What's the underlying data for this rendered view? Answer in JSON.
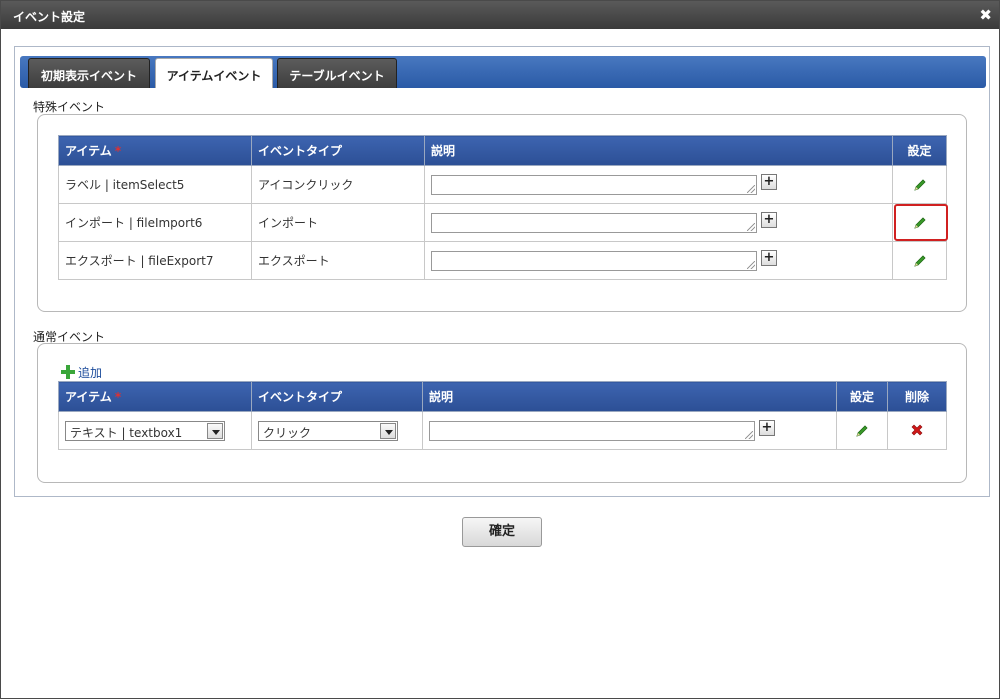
{
  "dialog": {
    "title": "イベント設定",
    "close_symbol": "✖"
  },
  "tabs": [
    {
      "label": "初期表示イベント",
      "active": false
    },
    {
      "label": "アイテムイベント",
      "active": true
    },
    {
      "label": "テーブルイベント",
      "active": false
    }
  ],
  "special_events": {
    "legend": "特殊イベント",
    "headers": {
      "item": "アイテム",
      "required_mark": "*",
      "event_type": "イベントタイプ",
      "description": "説明",
      "settings": "設定"
    },
    "rows": [
      {
        "item": "ラベル | itemSelect5",
        "event_type": "アイコンクリック",
        "description": ""
      },
      {
        "item": "インポート | fileImport6",
        "event_type": "インポート",
        "description": "",
        "highlighted": true
      },
      {
        "item": "エクスポート | fileExport7",
        "event_type": "エクスポート",
        "description": ""
      }
    ]
  },
  "normal_events": {
    "legend": "通常イベント",
    "add_label": "追加",
    "headers": {
      "item": "アイテム",
      "required_mark": "*",
      "event_type": "イベントタイプ",
      "description": "説明",
      "settings": "設定",
      "delete": "削除"
    },
    "rows": [
      {
        "item_select": "テキスト | textbox1",
        "event_type_select": "クリック",
        "description": ""
      }
    ]
  },
  "ok_button": "確定",
  "colors": {
    "header_blue": "#2c4f95",
    "highlight_red": "#d02020",
    "pencil_green": "#3a9a2a",
    "delete_red": "#d01818"
  }
}
